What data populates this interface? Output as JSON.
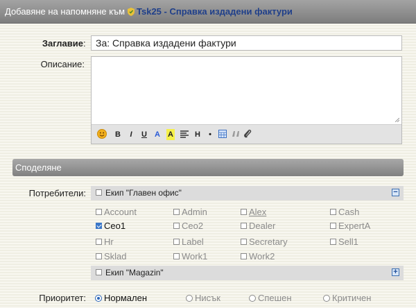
{
  "header": {
    "prefix": "Добавяне на напомняне към",
    "task": "Tsk25 - Справка издадени фактури"
  },
  "form": {
    "title_label": "Заглавие",
    "title_colon": ":",
    "title_value": "За: Справка издадени фактури",
    "desc_label": "Описание:"
  },
  "toolbar": {
    "bold": "B",
    "italic": "I",
    "underline": "U",
    "color": "A",
    "highlight": "A",
    "heading": "H",
    "bullet": "•"
  },
  "sharing": {
    "section_title": "Споделяне",
    "users_label": "Потребители:",
    "groups": [
      {
        "name": "Екип \"Главен офис\"",
        "toggle": "−",
        "users": [
          {
            "name": "Account",
            "checked": false
          },
          {
            "name": "Admin",
            "checked": false
          },
          {
            "name": "Alex",
            "checked": false
          },
          {
            "name": "Cash",
            "checked": false
          },
          {
            "name": "Ceo1",
            "checked": true
          },
          {
            "name": "Ceo2",
            "checked": false
          },
          {
            "name": "Dealer",
            "checked": false
          },
          {
            "name": "ExpertA",
            "checked": false
          },
          {
            "name": "Hr",
            "checked": false
          },
          {
            "name": "Label",
            "checked": false
          },
          {
            "name": "Secretary",
            "checked": false
          },
          {
            "name": "Sell1",
            "checked": false
          },
          {
            "name": "Sklad",
            "checked": false
          },
          {
            "name": "Work1",
            "checked": false
          },
          {
            "name": "Work2",
            "checked": false
          }
        ]
      },
      {
        "name": "Екип \"Magazin\"",
        "toggle": "+"
      }
    ]
  },
  "priority": {
    "label": "Приоритет:",
    "options": [
      "Нормален",
      "Нисък",
      "Спешен",
      "Критичен"
    ],
    "selected": "Нормален"
  },
  "colors": {
    "header_link": "#1f3f8a",
    "accent_blue": "#2a64b8",
    "emoji": "#f2b01e"
  }
}
